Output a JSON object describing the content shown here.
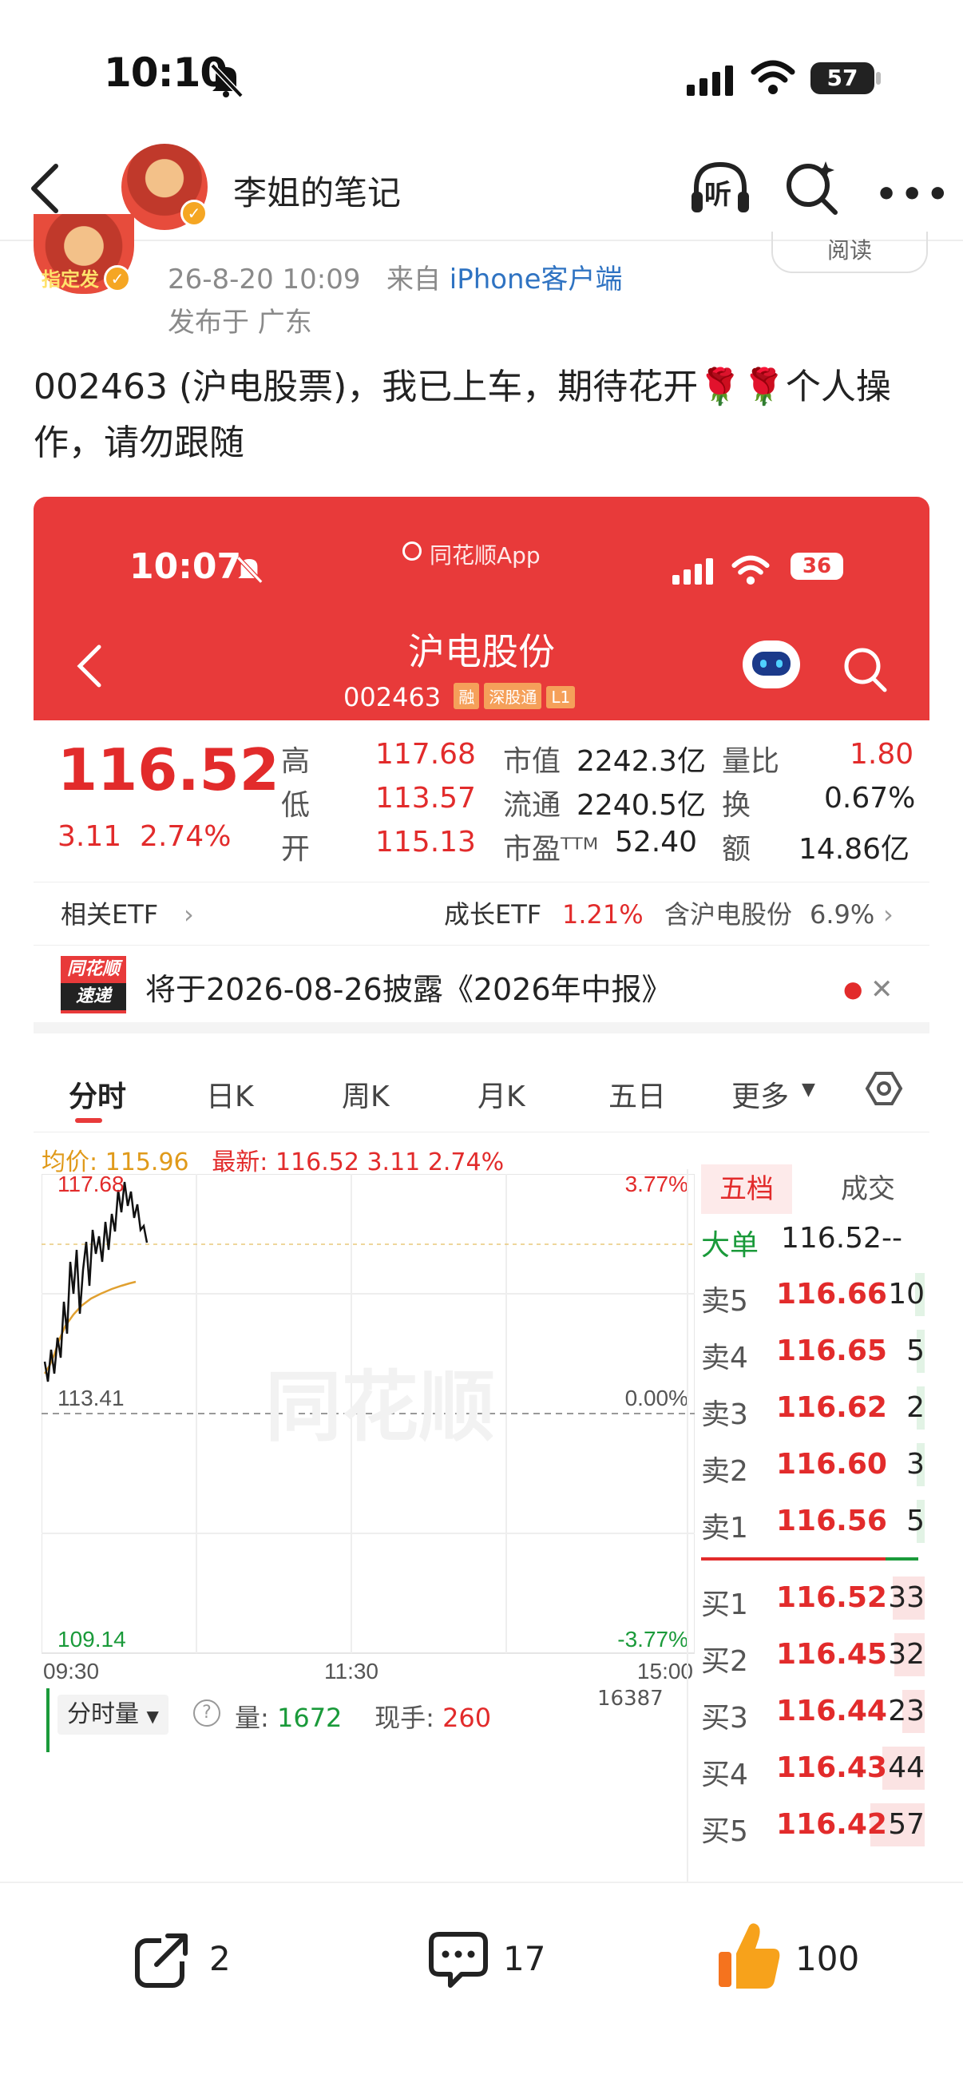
{
  "status_bar": {
    "time": "10:10",
    "battery": "57"
  },
  "nav": {
    "account_name": "李姐的笔记",
    "listen_label": "听"
  },
  "post": {
    "timestamp": "26-8-20 10:09",
    "source_prefix": "来自",
    "source_device": "iPhone客户端",
    "location": "发布于 广东",
    "read_label": "阅读",
    "text": "002463 (沪电股票)，我已上车，期待花开🌹🌹个人操作，请勿跟随",
    "avatar_caption": "指定发"
  },
  "stock_app": {
    "status_time": "10:07",
    "app_name": "同花顺App",
    "battery": "36",
    "stock_name": "沪电股份",
    "stock_code": "002463",
    "tags": [
      "融",
      "深股通",
      "L1"
    ],
    "price": "116.52",
    "change": "3.11",
    "change_pct": "2.74%",
    "quote": {
      "high_label": "高",
      "high": "117.68",
      "low_label": "低",
      "low": "113.57",
      "open_label": "开",
      "open": "115.13",
      "mktcap_label": "市值",
      "mktcap": "2242.3亿",
      "float_label": "流通",
      "float": "2240.5亿",
      "pe_label": "市盈ᵀᵀᴹ",
      "pe": "52.40",
      "volratio_label": "量比",
      "volratio": "1.80",
      "turnover_label": "换",
      "turnover": "0.67%",
      "amount_label": "额",
      "amount": "14.86亿"
    },
    "etf": {
      "related_label": "相关ETF",
      "growth_label": "成长ETF",
      "growth_pct": "1.21%",
      "holding_label": "含沪电股份",
      "holding_pct": "6.9%"
    },
    "notice": {
      "logo_top": "同花顺",
      "logo_bottom": "速递",
      "text": "将于2026-08-26披露《2026年中报》"
    },
    "tabs": [
      "分时",
      "日K",
      "周K",
      "月K",
      "五日",
      "更多"
    ],
    "avg_line": {
      "avg_label": "均价:",
      "avg": "115.96",
      "latest_label": "最新:",
      "latest": "116.52",
      "chg": "3.11",
      "chg_pct": "2.74%"
    },
    "chart": {
      "y_top": "117.68",
      "y_mid": "113.41",
      "y_bottom": "109.14",
      "pct_top": "3.77%",
      "pct_mid": "0.00%",
      "pct_bottom": "-3.77%",
      "x_start": "09:30",
      "x_mid": "11:30",
      "x_end": "15:00",
      "watermark": "同花顺"
    },
    "volume_row": {
      "label": "分时量",
      "vol_label": "量:",
      "vol": "1672",
      "hand_label": "现手:",
      "hand": "260",
      "max": "16387"
    },
    "orderbook": {
      "tab_depth": "五档",
      "tab_trades": "成交",
      "big_label": "大单",
      "big_price": "116.52",
      "big_vol": "--",
      "asks": [
        {
          "label": "卖5",
          "price": "116.66",
          "vol": "10"
        },
        {
          "label": "卖4",
          "price": "116.65",
          "vol": "5"
        },
        {
          "label": "卖3",
          "price": "116.62",
          "vol": "2"
        },
        {
          "label": "卖2",
          "price": "116.60",
          "vol": "3"
        },
        {
          "label": "卖1",
          "price": "116.56",
          "vol": "5"
        }
      ],
      "bids": [
        {
          "label": "买1",
          "price": "116.52",
          "vol": "33"
        },
        {
          "label": "买2",
          "price": "116.45",
          "vol": "32"
        },
        {
          "label": "买3",
          "price": "116.44",
          "vol": "23"
        },
        {
          "label": "买4",
          "price": "116.43",
          "vol": "44"
        },
        {
          "label": "买5",
          "price": "116.42",
          "vol": "57"
        }
      ]
    }
  },
  "actions": {
    "share_count": "2",
    "comment_count": "17",
    "like_count": "100"
  }
}
